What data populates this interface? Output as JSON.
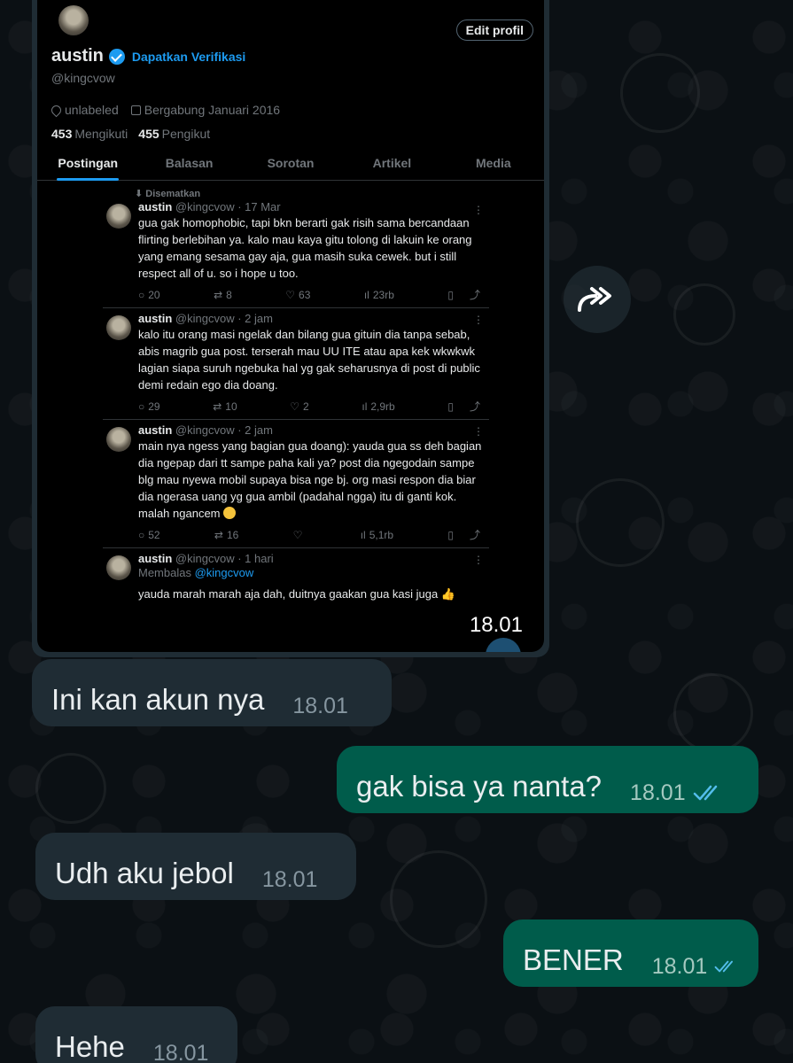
{
  "screenshot": {
    "display_name": "austin",
    "verify_link": "Dapatkan Verifikasi",
    "handle": "@kingcvow",
    "edit_button": "Edit profil",
    "location": "unlabeled",
    "joined": "Bergabung Januari 2016",
    "following_count": "453",
    "following_label": "Mengikuti",
    "followers_count": "455",
    "followers_label": "Pengikut",
    "tabs": [
      "Postingan",
      "Balasan",
      "Sorotan",
      "Artikel",
      "Media"
    ],
    "pinned_label": "Disematkan",
    "tweets": [
      {
        "name": "austin",
        "meta": "@kingcvow · 17 Mar",
        "text": "gua gak homophobic, tapi bkn berarti gak risih sama bercandaan flirting berlebihan ya. kalo mau kaya gitu tolong di lakuin ke orang yang emang sesama gay aja, gua masih suka cewek. but i still respect all of u. so i hope u too.",
        "replies": "20",
        "reposts": "8",
        "likes": "63",
        "views": "23rb"
      },
      {
        "name": "austin",
        "meta": "@kingcvow · 2 jam",
        "text": "kalo itu orang masi ngelak dan bilang gua gituin dia tanpa sebab, abis magrib gua post. terserah mau UU ITE atau apa kek wkwkwk lagian siapa suruh ngebuka hal yg gak seharusnya di post di public demi redain ego dia doang.",
        "replies": "29",
        "reposts": "10",
        "likes": "2",
        "views": "2,9rb"
      },
      {
        "name": "austin",
        "meta": "@kingcvow · 2 jam",
        "text": "main nya ngess yang bagian gua doang): yauda gua ss deh bagian dia ngepap dari tt sampe paha kali ya? post dia ngegodain sampe blg mau nyewa mobil supaya bisa nge bj. org masi respon dia biar dia ngerasa uang yg gua ambil (padahal ngga) itu di ganti kok. malah ngancem",
        "replies": "52",
        "reposts": "16",
        "likes": "",
        "views": "5,1rb"
      },
      {
        "name": "austin",
        "meta": "@kingcvow · 1 hari",
        "reply_prefix": "Membalas",
        "reply_handle": "@kingcvow",
        "text": "yauda marah marah aja dah, duitnya gaakan gua kasi juga"
      }
    ]
  },
  "image_time": "18.01",
  "messages": [
    {
      "dir": "in",
      "text": "Ini kan akun nya",
      "time": "18.01"
    },
    {
      "dir": "out",
      "text": "gak bisa ya nanta?",
      "time": "18.01"
    },
    {
      "dir": "in",
      "text": "Udh aku jebol",
      "time": "18.01"
    },
    {
      "dir": "out",
      "text": "BENER",
      "time": "18.01"
    },
    {
      "dir": "in",
      "text": "Hehe",
      "time": "18.01"
    }
  ],
  "colors": {
    "incoming_bubble": "#1f2c34",
    "outgoing_bubble": "#005c4b",
    "read_ticks": "#53bdeb",
    "twitter_blue": "#1d9bf0"
  }
}
